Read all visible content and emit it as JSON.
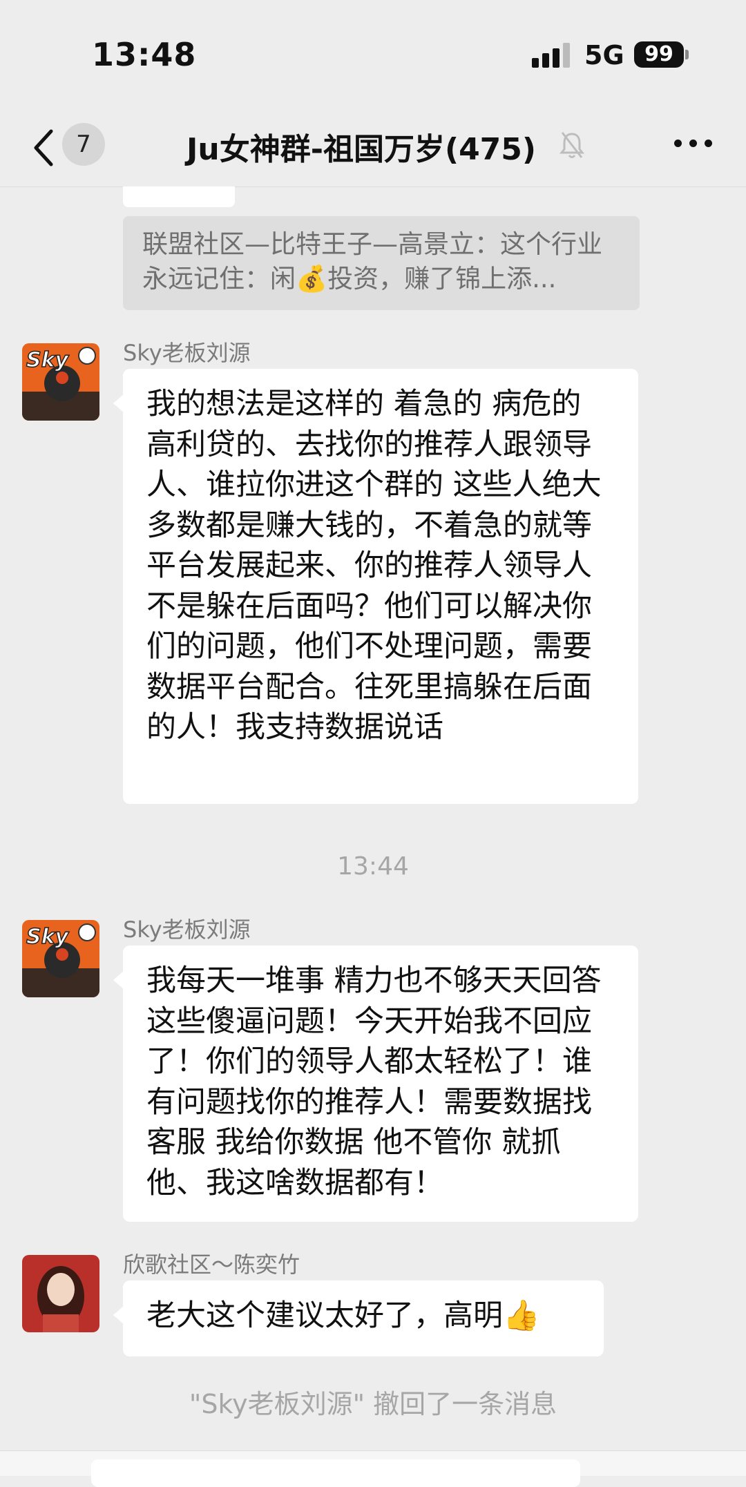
{
  "status": {
    "time": "13:48",
    "network": "5G",
    "battery": "99"
  },
  "header": {
    "unread_count": "7",
    "title": "Ju女神群-祖国万岁(475)"
  },
  "quoted_message": {
    "text": "联盟社区—比特王子—高景立：这个行业永远记住：闲💰投资，赚了锦上添..."
  },
  "messages": [
    {
      "sender": "Sky老板刘源",
      "avatar_label": "Sky",
      "text": "我的想法是这样的 着急的 病危的 高利贷的、去找你的推荐人跟领导人、谁拉你进这个群的 这些人绝大多数都是赚大钱的，不着急的就等平台发展起来、你的推荐人领导人不是躲在后面吗？他们可以解决你们的问题，他们不处理问题，需要数据平台配合。往死里搞躲在后面的人！我支持数据说话"
    },
    {
      "sender": "Sky老板刘源",
      "avatar_label": "Sky",
      "text": "我每天一堆事 精力也不够天天回答这些傻逼问题！今天开始我不回应了！你们的领导人都太轻松了！谁有问题找你的推荐人！需要数据找客服 我给你数据 他不管你 就抓他、我这啥数据都有！"
    },
    {
      "sender": "欣歌社区～陈奕竹",
      "text": "老大这个建议太好了，高明👍"
    }
  ],
  "timestamp": "13:44",
  "system_notice": "\"Sky老板刘源\" 撤回了一条消息",
  "colors": {
    "background": "#ededed",
    "bubble": "#ffffff",
    "muted_text": "#a6a6a6"
  }
}
